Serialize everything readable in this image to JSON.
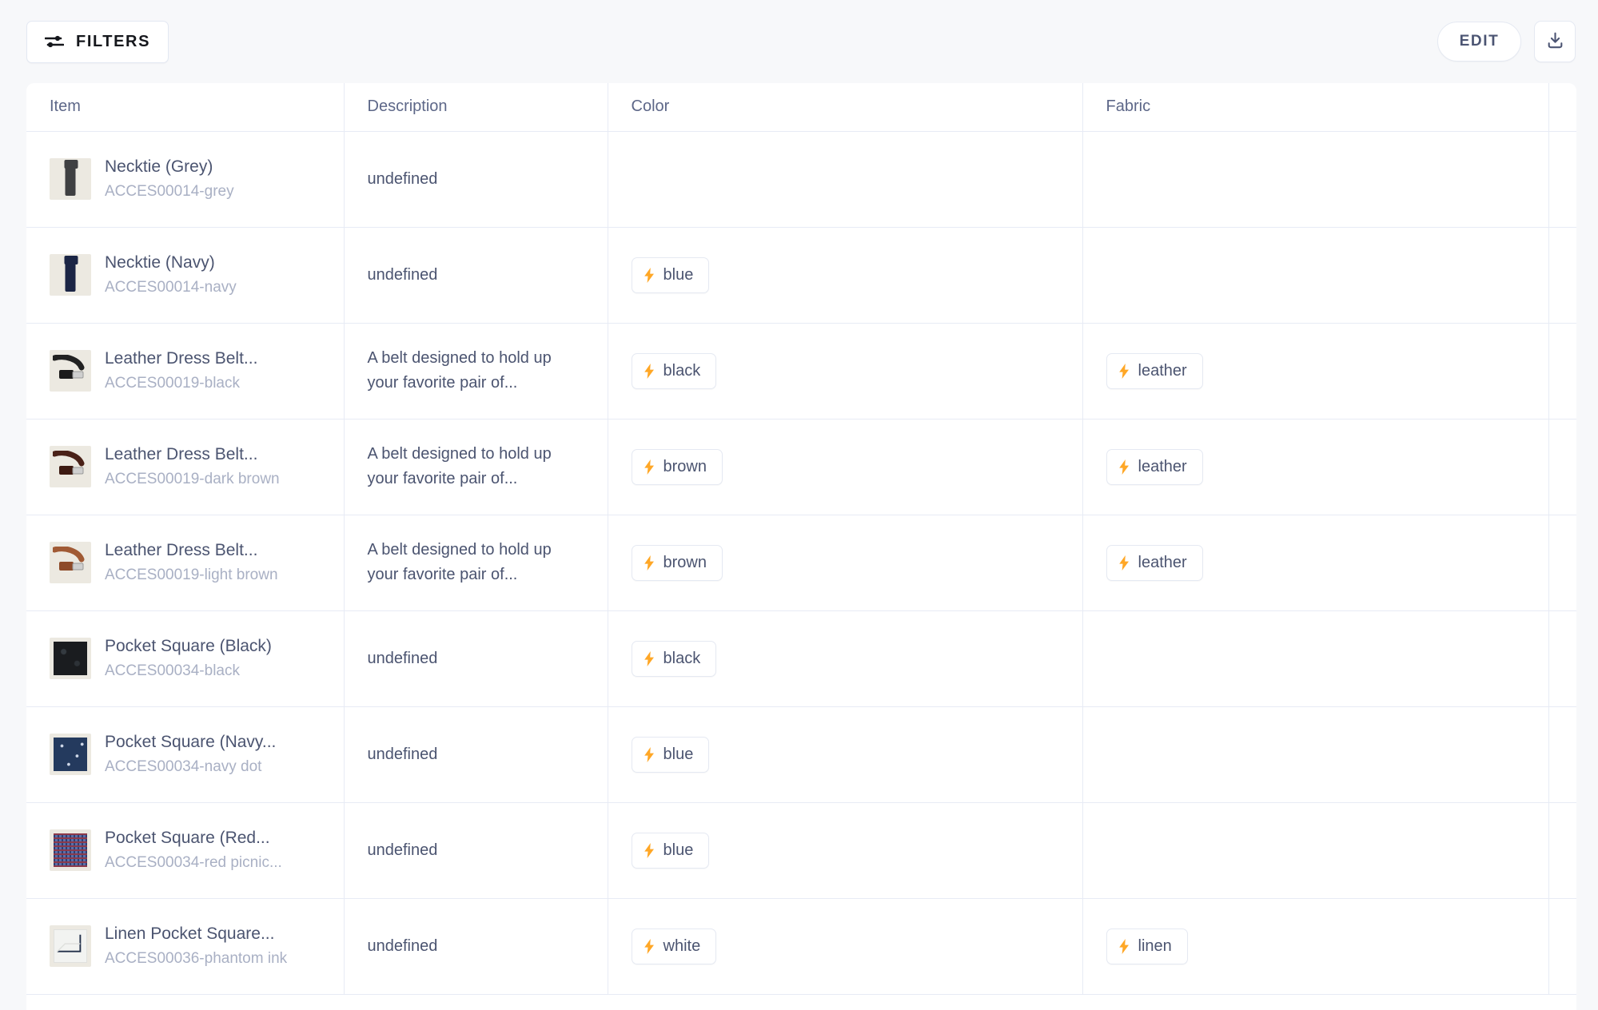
{
  "toolbar": {
    "filters_label": "FILTERS",
    "filters_icon": "sliders-icon",
    "edit_label": "EDIT",
    "download_icon": "download-icon"
  },
  "table": {
    "columns": [
      "Item",
      "Description",
      "Color",
      "Fabric",
      ""
    ],
    "rows": [
      {
        "name": "Necktie (Grey)",
        "sku": "ACCES00014-grey",
        "description": "undefined",
        "color": "",
        "fabric": "",
        "thumb": "necktie-grey"
      },
      {
        "name": "Necktie (Navy)",
        "sku": "ACCES00014-navy",
        "description": "undefined",
        "color": "blue",
        "fabric": "",
        "thumb": "necktie-navy"
      },
      {
        "name": "Leather Dress Belt...",
        "sku": "ACCES00019-black",
        "description": "A belt designed to hold up your favorite pair of...",
        "color": "black",
        "fabric": "leather",
        "thumb": "belt-black"
      },
      {
        "name": "Leather Dress Belt...",
        "sku": "ACCES00019-dark brown",
        "description": "A belt designed to hold up your favorite pair of...",
        "color": "brown",
        "fabric": "leather",
        "thumb": "belt-dark-brown"
      },
      {
        "name": "Leather Dress Belt...",
        "sku": "ACCES00019-light brown",
        "description": "A belt designed to hold up your favorite pair of...",
        "color": "brown",
        "fabric": "leather",
        "thumb": "belt-light-brown"
      },
      {
        "name": "Pocket Square (Black)",
        "sku": "ACCES00034-black",
        "description": "undefined",
        "color": "black",
        "fabric": "",
        "thumb": "pocket-square-black"
      },
      {
        "name": "Pocket Square (Navy...",
        "sku": "ACCES00034-navy dot",
        "description": "undefined",
        "color": "blue",
        "fabric": "",
        "thumb": "pocket-square-navy-dot"
      },
      {
        "name": "Pocket Square (Red...",
        "sku": "ACCES00034-red picnic...",
        "description": "undefined",
        "color": "blue",
        "fabric": "",
        "thumb": "pocket-square-red-picnic"
      },
      {
        "name": "Linen Pocket Square...",
        "sku": "ACCES00036-phantom ink",
        "description": "undefined",
        "color": "white",
        "fabric": "linen",
        "thumb": "linen-pocket-square"
      }
    ]
  },
  "colors": {
    "page_background": "#f7f8fa",
    "surface": "#ffffff",
    "grid_line": "#e7ebf5",
    "text_primary": "#4b5470",
    "text_muted": "#a9b0c4",
    "header_text": "#5d6788",
    "chip_border": "#e5e9f2",
    "bolt_accent": "#ffa726"
  }
}
